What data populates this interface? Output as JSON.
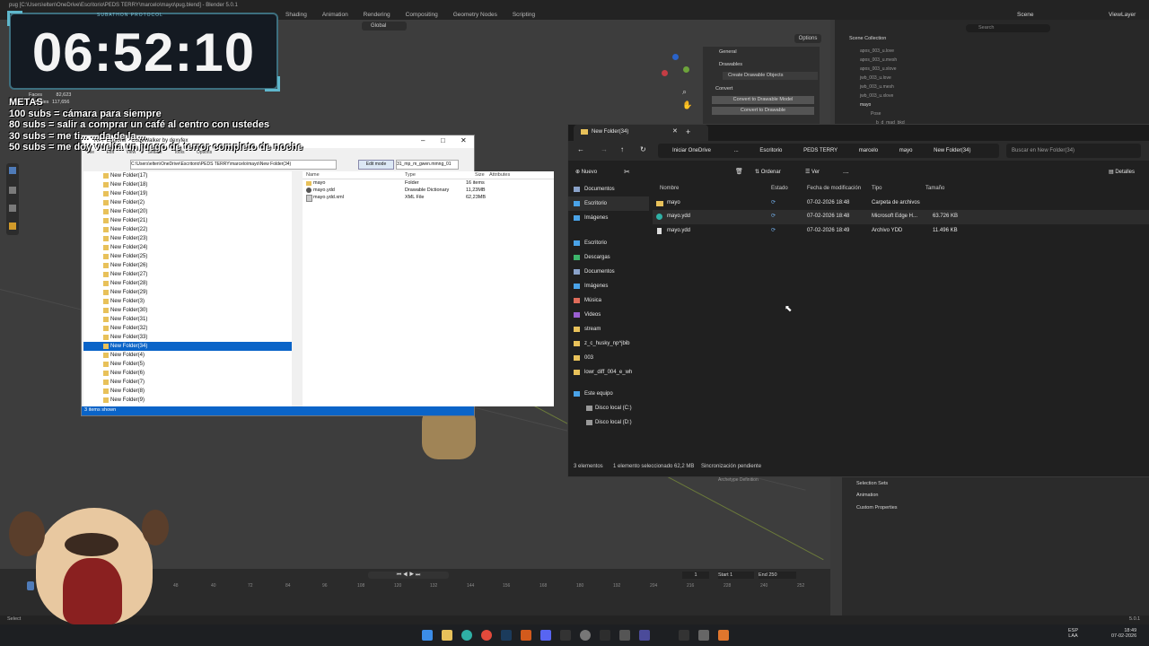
{
  "blender": {
    "title": "pug [C:\\Users\\elten\\OneDrive\\Escritorio\\PEDS TERRY\\marcelo\\mayo\\pug.blend] - Blender 5.0.1",
    "tabs": [
      "Shading",
      "Animation",
      "Rendering",
      "Compositing",
      "Geometry Nodes",
      "Scripting"
    ],
    "scene_label": "Scene",
    "view_layer_label": "ViewLayer",
    "orientation": "Global",
    "options_label": "Options",
    "search_placeholder": "Search",
    "scene_collection": "Scene Collection",
    "outliner_items": [
      "apos_003_u.love",
      "apos_003_u.mesh",
      "apos_003_u.xlove",
      "jwb_003_u.love",
      "jwb_003_u.mesh",
      "jwb_003_u.xlove",
      "mayo",
      "Pose",
      "b_d_mad_bkd"
    ],
    "n_panel": {
      "general": "General",
      "drawables": "Drawables",
      "create_drawable": "Create Drawable Objects",
      "convert": "Convert",
      "convert_model": "Convert to Drawable Model",
      "convert_drawable": "Convert to Drawable"
    },
    "stats": {
      "faces_label": "Faces",
      "faces": "82,623",
      "tris_label": "Triangles",
      "tris": "117,656"
    },
    "props": {
      "selection_sets": "Selection Sets",
      "animation": "Animation",
      "custom_properties": "Custom Properties",
      "archetype": "Archetype Definition"
    },
    "timeline": {
      "frame": "1",
      "start_label": "Start",
      "start": "1",
      "end_label": "End",
      "end": "250",
      "ticks": [
        "48",
        "40",
        "72",
        "84",
        "96",
        "108",
        "120",
        "132",
        "144",
        "156",
        "168",
        "180",
        "192",
        "204",
        "216",
        "228",
        "240",
        "252"
      ]
    },
    "status_select": "Select",
    "version": "5.0.1"
  },
  "overlay": {
    "banner": "SUBATHON PROTOCOL",
    "timer": "06:52:10",
    "goals_title": "METAS",
    "goals": [
      "100 subs = cámara para siempre",
      "80 subs = salir a comprar un café al centro con ustedes",
      "30 subs = me ti... ...da de la ...",
      "50 subs = me doy vuelta un juego de terror completo de noche"
    ]
  },
  "codewalker": {
    "title": "RPF Explorer - CodeWalker by dexyfex",
    "menu": [
      "File",
      "Edit",
      "View",
      "Search",
      "Tools",
      "Options"
    ],
    "path": "C:\\Users\\elten\\OneDrive\\Escritorio\\PEDS TERRY\\marcelo\\mayo\\New Folder(34)",
    "edit_mode": "Edit mode",
    "search_value": "31_mp_m_gwen.mmng_01",
    "tree": [
      "New Folder(17)",
      "New Folder(18)",
      "New Folder(19)",
      "New Folder(2)",
      "New Folder(20)",
      "New Folder(21)",
      "New Folder(22)",
      "New Folder(23)",
      "New Folder(24)",
      "New Folder(25)",
      "New Folder(26)",
      "New Folder(27)",
      "New Folder(28)",
      "New Folder(29)",
      "New Folder(3)",
      "New Folder(30)",
      "New Folder(31)",
      "New Folder(32)",
      "New Folder(33)",
      "New Folder(34)",
      "New Folder(4)",
      "New Folder(5)",
      "New Folder(6)",
      "New Folder(7)",
      "New Folder(8)",
      "New Folder(9)"
    ],
    "selected_tree": "New Folder(34)",
    "columns": [
      "Name",
      "Type",
      "Size",
      "Attributes"
    ],
    "files": [
      {
        "name": "mayo",
        "type": "Folder",
        "size": "16 items"
      },
      {
        "name": "mayo.ydd",
        "type": "Drawable Dictionary",
        "size": "11,23MB"
      },
      {
        "name": "mayo.ydd.xml",
        "type": "XML File",
        "size": "62,23MB"
      }
    ],
    "status": "3 items shown"
  },
  "explorer": {
    "tab_title": "New Folder(34)",
    "breadcrumb": [
      "Iniciar OneDrive",
      "...",
      "Escritorio",
      "PEDS TERRY",
      "marcelo",
      "mayo",
      "New Folder(34)"
    ],
    "search_placeholder": "Buscar en New Folder(34)",
    "commands": {
      "new": "Nuevo",
      "sort": "Ordenar",
      "view": "Ver",
      "more": "...",
      "details": "Detalles"
    },
    "nav_top": [
      "Documentos",
      "Escritorio",
      "Imágenes"
    ],
    "nav_quick": [
      "Escritorio",
      "Descargas",
      "Documentos",
      "Imágenes",
      "Música",
      "Videos",
      "stream",
      "z_c_husky_np^jbib",
      "003",
      "lowr_diff_004_e_wh"
    ],
    "nav_pc": [
      "Este equipo",
      "Disco local (C:)",
      "Disco local (D:)"
    ],
    "columns": [
      "Nombre",
      "Estado",
      "Fecha de modificación",
      "Tipo",
      "Tamaño"
    ],
    "files": [
      {
        "name": "mayo",
        "date": "07-02-2026 18:48",
        "type": "Carpeta de archivos",
        "size": ""
      },
      {
        "name": "mayo.ydd",
        "date": "07-02-2026 18:48",
        "type": "Microsoft Edge H...",
        "size": "63.726 KB"
      },
      {
        "name": "mayo.ydd",
        "date": "07-02-2026 18:49",
        "type": "Archivo YDD",
        "size": "11.496 KB"
      }
    ],
    "status": {
      "count": "3 elementos",
      "selected": "1 elemento seleccionado  62,2 MB",
      "sync": "Sincronización pendiente"
    }
  },
  "taskbar": {
    "lang": "ESP",
    "lang2": "LAA",
    "time": "18:49",
    "date": "07-02-2026"
  }
}
